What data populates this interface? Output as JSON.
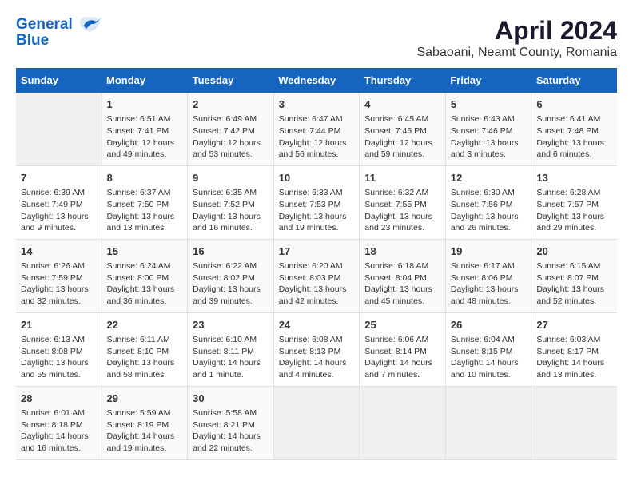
{
  "header": {
    "logo_line1": "General",
    "logo_line2": "Blue",
    "title": "April 2024",
    "subtitle": "Sabaoani, Neamt County, Romania"
  },
  "calendar": {
    "days_of_week": [
      "Sunday",
      "Monday",
      "Tuesday",
      "Wednesday",
      "Thursday",
      "Friday",
      "Saturday"
    ],
    "weeks": [
      [
        {
          "day": "",
          "content": ""
        },
        {
          "day": "1",
          "content": "Sunrise: 6:51 AM\nSunset: 7:41 PM\nDaylight: 12 hours\nand 49 minutes."
        },
        {
          "day": "2",
          "content": "Sunrise: 6:49 AM\nSunset: 7:42 PM\nDaylight: 12 hours\nand 53 minutes."
        },
        {
          "day": "3",
          "content": "Sunrise: 6:47 AM\nSunset: 7:44 PM\nDaylight: 12 hours\nand 56 minutes."
        },
        {
          "day": "4",
          "content": "Sunrise: 6:45 AM\nSunset: 7:45 PM\nDaylight: 12 hours\nand 59 minutes."
        },
        {
          "day": "5",
          "content": "Sunrise: 6:43 AM\nSunset: 7:46 PM\nDaylight: 13 hours\nand 3 minutes."
        },
        {
          "day": "6",
          "content": "Sunrise: 6:41 AM\nSunset: 7:48 PM\nDaylight: 13 hours\nand 6 minutes."
        }
      ],
      [
        {
          "day": "7",
          "content": "Sunrise: 6:39 AM\nSunset: 7:49 PM\nDaylight: 13 hours\nand 9 minutes."
        },
        {
          "day": "8",
          "content": "Sunrise: 6:37 AM\nSunset: 7:50 PM\nDaylight: 13 hours\nand 13 minutes."
        },
        {
          "day": "9",
          "content": "Sunrise: 6:35 AM\nSunset: 7:52 PM\nDaylight: 13 hours\nand 16 minutes."
        },
        {
          "day": "10",
          "content": "Sunrise: 6:33 AM\nSunset: 7:53 PM\nDaylight: 13 hours\nand 19 minutes."
        },
        {
          "day": "11",
          "content": "Sunrise: 6:32 AM\nSunset: 7:55 PM\nDaylight: 13 hours\nand 23 minutes."
        },
        {
          "day": "12",
          "content": "Sunrise: 6:30 AM\nSunset: 7:56 PM\nDaylight: 13 hours\nand 26 minutes."
        },
        {
          "day": "13",
          "content": "Sunrise: 6:28 AM\nSunset: 7:57 PM\nDaylight: 13 hours\nand 29 minutes."
        }
      ],
      [
        {
          "day": "14",
          "content": "Sunrise: 6:26 AM\nSunset: 7:59 PM\nDaylight: 13 hours\nand 32 minutes."
        },
        {
          "day": "15",
          "content": "Sunrise: 6:24 AM\nSunset: 8:00 PM\nDaylight: 13 hours\nand 36 minutes."
        },
        {
          "day": "16",
          "content": "Sunrise: 6:22 AM\nSunset: 8:02 PM\nDaylight: 13 hours\nand 39 minutes."
        },
        {
          "day": "17",
          "content": "Sunrise: 6:20 AM\nSunset: 8:03 PM\nDaylight: 13 hours\nand 42 minutes."
        },
        {
          "day": "18",
          "content": "Sunrise: 6:18 AM\nSunset: 8:04 PM\nDaylight: 13 hours\nand 45 minutes."
        },
        {
          "day": "19",
          "content": "Sunrise: 6:17 AM\nSunset: 8:06 PM\nDaylight: 13 hours\nand 48 minutes."
        },
        {
          "day": "20",
          "content": "Sunrise: 6:15 AM\nSunset: 8:07 PM\nDaylight: 13 hours\nand 52 minutes."
        }
      ],
      [
        {
          "day": "21",
          "content": "Sunrise: 6:13 AM\nSunset: 8:08 PM\nDaylight: 13 hours\nand 55 minutes."
        },
        {
          "day": "22",
          "content": "Sunrise: 6:11 AM\nSunset: 8:10 PM\nDaylight: 13 hours\nand 58 minutes."
        },
        {
          "day": "23",
          "content": "Sunrise: 6:10 AM\nSunset: 8:11 PM\nDaylight: 14 hours\nand 1 minute."
        },
        {
          "day": "24",
          "content": "Sunrise: 6:08 AM\nSunset: 8:13 PM\nDaylight: 14 hours\nand 4 minutes."
        },
        {
          "day": "25",
          "content": "Sunrise: 6:06 AM\nSunset: 8:14 PM\nDaylight: 14 hours\nand 7 minutes."
        },
        {
          "day": "26",
          "content": "Sunrise: 6:04 AM\nSunset: 8:15 PM\nDaylight: 14 hours\nand 10 minutes."
        },
        {
          "day": "27",
          "content": "Sunrise: 6:03 AM\nSunset: 8:17 PM\nDaylight: 14 hours\nand 13 minutes."
        }
      ],
      [
        {
          "day": "28",
          "content": "Sunrise: 6:01 AM\nSunset: 8:18 PM\nDaylight: 14 hours\nand 16 minutes."
        },
        {
          "day": "29",
          "content": "Sunrise: 5:59 AM\nSunset: 8:19 PM\nDaylight: 14 hours\nand 19 minutes."
        },
        {
          "day": "30",
          "content": "Sunrise: 5:58 AM\nSunset: 8:21 PM\nDaylight: 14 hours\nand 22 minutes."
        },
        {
          "day": "",
          "content": ""
        },
        {
          "day": "",
          "content": ""
        },
        {
          "day": "",
          "content": ""
        },
        {
          "day": "",
          "content": ""
        }
      ]
    ]
  }
}
